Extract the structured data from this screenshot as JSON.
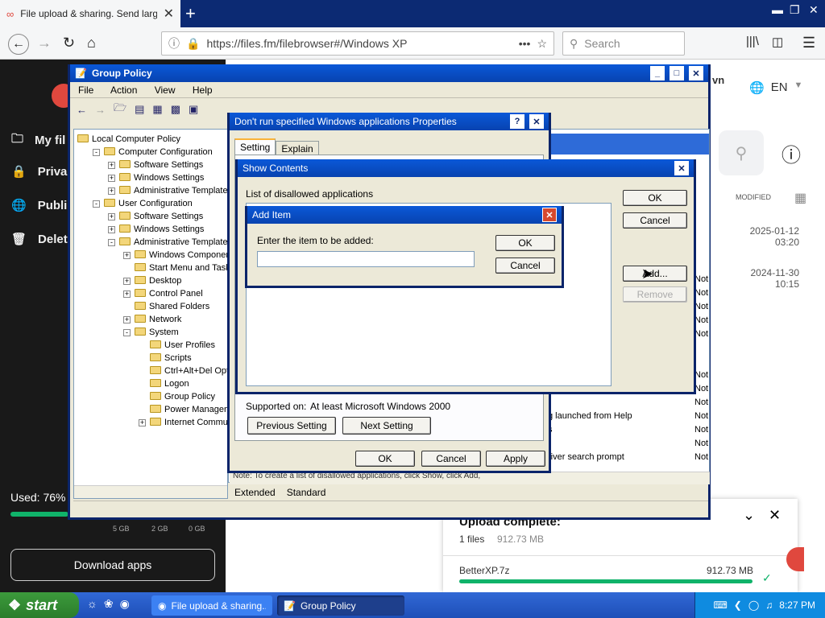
{
  "browser": {
    "tab_title": "File upload & sharing. Send large p",
    "url": "https://files.fm/filebrowser#/Windows XP",
    "search_placeholder": "Search"
  },
  "filesfm": {
    "sidebar": [
      {
        "label": "My fil",
        "icon": "folder-icon"
      },
      {
        "label": "Priva",
        "icon": "lock-icon"
      },
      {
        "label": "Publi",
        "icon": "globe-icon"
      },
      {
        "label": "Delet",
        "icon": "trash-icon"
      }
    ],
    "used": "Used: 76%",
    "legend": [
      "5 GB",
      "2 GB",
      "0 GB"
    ],
    "download_apps": "Download apps",
    "own_label": "vn",
    "lang": "EN",
    "modified_header": "MODIFIED",
    "dates": [
      {
        "date": "2025-01-12",
        "time": "03:20"
      },
      {
        "date": "2024-11-30",
        "time": "10:15"
      }
    ],
    "upload": {
      "title": "Upload complete:",
      "count": "1 files",
      "size": "912.73 MB",
      "file_name": "BetterXP.7z",
      "file_size": "912.73 MB",
      "progress": 1.0
    }
  },
  "gpedit": {
    "title": "Group Policy",
    "menu": [
      "File",
      "Action",
      "View",
      "Help"
    ],
    "tree": [
      {
        "label": "Local Computer Policy",
        "level": 0,
        "pm": ""
      },
      {
        "label": "Computer Configuration",
        "level": 1,
        "pm": "-"
      },
      {
        "label": "Software Settings",
        "level": 2,
        "pm": "+"
      },
      {
        "label": "Windows Settings",
        "level": 2,
        "pm": "+"
      },
      {
        "label": "Administrative Templates",
        "level": 2,
        "pm": "+"
      },
      {
        "label": "User Configuration",
        "level": 1,
        "pm": "-"
      },
      {
        "label": "Software Settings",
        "level": 2,
        "pm": "+"
      },
      {
        "label": "Windows Settings",
        "level": 2,
        "pm": "+"
      },
      {
        "label": "Administrative Templates",
        "level": 2,
        "pm": "-"
      },
      {
        "label": "Windows Components",
        "level": 3,
        "pm": "+"
      },
      {
        "label": "Start Menu and Taskba",
        "level": 3,
        "pm": ""
      },
      {
        "label": "Desktop",
        "level": 3,
        "pm": "+"
      },
      {
        "label": "Control Panel",
        "level": 3,
        "pm": "+"
      },
      {
        "label": "Shared Folders",
        "level": 3,
        "pm": ""
      },
      {
        "label": "Network",
        "level": 3,
        "pm": "+"
      },
      {
        "label": "System",
        "level": 3,
        "pm": "-"
      },
      {
        "label": "User Profiles",
        "level": 4,
        "pm": ""
      },
      {
        "label": "Scripts",
        "level": 4,
        "pm": ""
      },
      {
        "label": "Ctrl+Alt+Del Optio",
        "level": 4,
        "pm": ""
      },
      {
        "label": "Logon",
        "level": 4,
        "pm": ""
      },
      {
        "label": "Group Policy",
        "level": 4,
        "pm": ""
      },
      {
        "label": "Power Managemen",
        "level": 4,
        "pm": ""
      },
      {
        "label": "Internet Communic",
        "level": 4,
        "pm": "+"
      }
    ],
    "right_rows": [
      {
        "text": "",
        "state": "Not"
      },
      {
        "text": "",
        "state": "Not"
      },
      {
        "text": "",
        "state": "Not"
      },
      {
        "text": "",
        "state": "Not"
      },
      {
        "text": "",
        "state": "Not"
      },
      {
        "text": "",
        "state": "Not"
      },
      {
        "text": "",
        "state": "Not"
      },
      {
        "text": "",
        "state": "Not"
      },
      {
        "text": "g launched from Help",
        "state": "Not"
      },
      {
        "text": "s",
        "state": "Not"
      },
      {
        "text": "",
        "state": "Not"
      },
      {
        "text": "river search prompt",
        "state": "Not"
      }
    ],
    "tabs": [
      "Extended",
      "Standard"
    ],
    "note": "Note: To create a list of disallowed applications, click Show, click Add,"
  },
  "props": {
    "title": "Don't run specified Windows applications Properties",
    "tabs": [
      "Setting",
      "Explain"
    ],
    "supported_label": "Supported on:",
    "supported_value": "At least Microsoft Windows 2000",
    "prev": "Previous Setting",
    "next": "Next Setting",
    "ok": "OK",
    "cancel": "Cancel",
    "apply": "Apply"
  },
  "show": {
    "title": "Show Contents",
    "list_label": "List of disallowed applications",
    "ok": "OK",
    "cancel": "Cancel",
    "add": "Add...",
    "remove": "Remove"
  },
  "additem": {
    "title": "Add Item",
    "label": "Enter the item to be added:",
    "value": "",
    "ok": "OK",
    "cancel": "Cancel"
  },
  "taskbar": {
    "start": "start",
    "tasks": [
      "File upload & sharing....",
      "Group Policy"
    ],
    "clock": "8:27 PM"
  }
}
